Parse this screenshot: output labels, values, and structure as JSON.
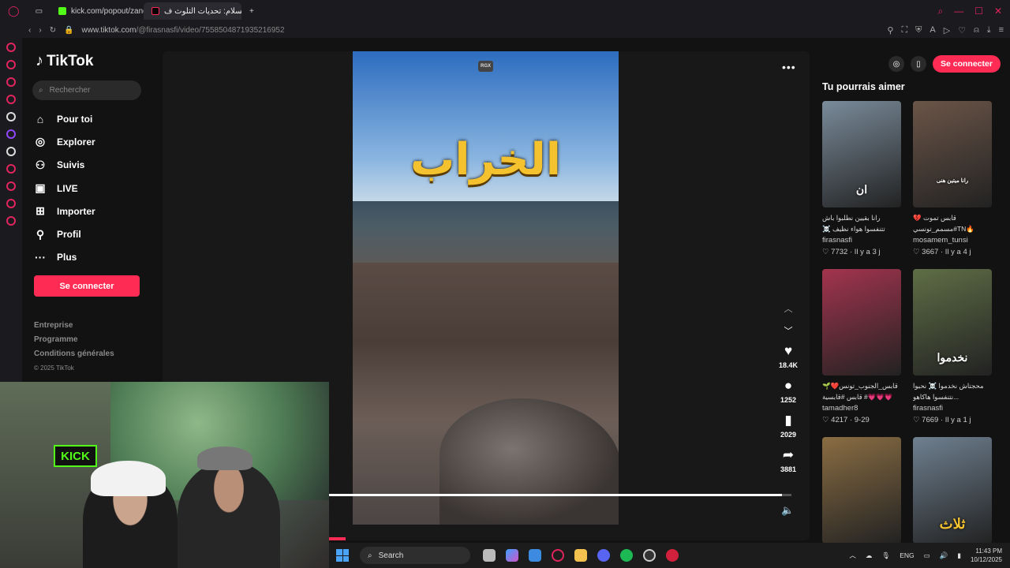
{
  "browser": {
    "tabs": [
      {
        "title": "kick.com/popout/zanoun..."
      },
      {
        "title": "شط السلام: تحديات التلوث ف..."
      }
    ],
    "url_prefix": "www.tiktok.com",
    "url_path": "/@firasnasfi/video/7558504871935216952"
  },
  "tiktok": {
    "brand": "TikTok",
    "search_placeholder": "Rechercher",
    "nav": [
      {
        "label": "Pour toi",
        "icon": "home-icon"
      },
      {
        "label": "Explorer",
        "icon": "compass-icon"
      },
      {
        "label": "Suivis",
        "icon": "following-icon"
      },
      {
        "label": "LIVE",
        "icon": "live-icon"
      },
      {
        "label": "Importer",
        "icon": "upload-icon"
      },
      {
        "label": "Profil",
        "icon": "profile-icon"
      },
      {
        "label": "Plus",
        "icon": "more-icon"
      }
    ],
    "connect_label": "Se connecter",
    "footer": {
      "company": "Entreprise",
      "program": "Programme",
      "terms": "Conditions générales",
      "copyright": "© 2025 TikTok"
    }
  },
  "video": {
    "overlay_title": "الخراب",
    "watermark": "RGX",
    "likes": "18.4K",
    "comments": "1252",
    "saves": "2029",
    "shares": "3881",
    "progress": 0.98
  },
  "rail": {
    "connect_label": "Se connecter",
    "title": "Tu pourrais aimer",
    "cards": [
      {
        "caption": "رانا بقيين نطلبوا باش تتنفسوا هواء نظيف ☠️ #قابس...",
        "user": "firasnasfi",
        "likes": "7732",
        "age": "Il y a 3 j",
        "label": "ان",
        "color": "#7a8b9a"
      },
      {
        "caption": "💔 قابس تموت مسمم_تونسي#TN🔥",
        "user": "mosamem_tunsi",
        "likes": "3667",
        "age": "Il y a 4 j",
        "label": "رانا ميتين هنى",
        "color": "#6b5548"
      },
      {
        "caption": "قابس_الجنوب_تونس❤️🌱 # قابس #قابسية💗💗💗#...",
        "user": "tamadher8",
        "likes": "4217",
        "age": "9-29",
        "label": "",
        "color": "#a3344e"
      },
      {
        "caption": "محجتاش نخدموا ☠️ نحبوا نتنفسوا هاكاهو...",
        "user": "firasnasfi",
        "likes": "7669",
        "age": "Il y a 1 j",
        "label": "نخدموا",
        "color": "#5f6e46"
      },
      {
        "caption": "",
        "user": "",
        "likes": "",
        "age": "",
        "label": "",
        "color": "#8a6d43"
      },
      {
        "caption": "",
        "user": "",
        "likes": "",
        "age": "",
        "label": "ثلاث",
        "color": "#6f8090"
      }
    ]
  },
  "taskbar": {
    "search_label": "Search",
    "lang": "ENG",
    "time": "11:43 PM",
    "date": "10/12/2025"
  },
  "webcam": {
    "sign": "KICK"
  }
}
